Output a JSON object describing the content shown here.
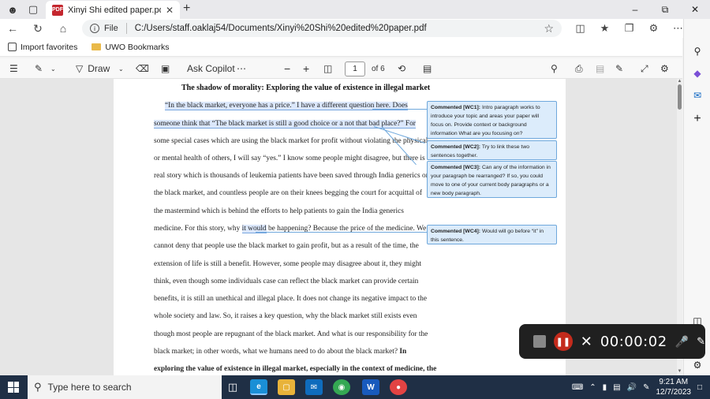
{
  "browser": {
    "tab_title": "Xinyi Shi edited paper.pdf",
    "address_label": "File",
    "url": "C:/Users/staff.oaklaj54/Documents/Xinyi%20Shi%20edited%20paper.pdf"
  },
  "bookmarks": {
    "import": "Import favorites",
    "folder": "UWO Bookmarks"
  },
  "pdf_toolbar": {
    "draw": "Draw",
    "ask_copilot": "Ask Copilot",
    "page_current": "1",
    "page_total": "of 6"
  },
  "document": {
    "title": "The shadow of morality: Exploring the value of existence in illegal market",
    "lines": [
      "“In the black market, everyone has a price.” I have a different question here. Does",
      "someone think that “The black market is still a good choice or a not that bad place?” For",
      "some special cases which are using the black market for profit without violating the physical",
      "or mental health of others, I will say “yes.” I know some people might disagree, but there is a",
      "real story which is thousands of leukemia patients have been saved through India generics on",
      "the black market, and countless people are on their knees begging the court for acquittal of",
      "the mastermind which is behind the efforts to help patients to gain the India generics",
      "medicine. For this story, why it would be happening? Because the price of the medicine. We",
      "cannot deny that people use the black market to gain profit, but as a result of the time, the",
      "extension of life is still a benefit. However, some people may disagree about it, they might",
      "think, even though some individuals case can reflect the black market can provide certain",
      "benefits, it is still an unethical and illegal place. It does not change its negative impact to the",
      "whole society and law. So, it raises a key question, why the black market still exists even",
      "though most people are repugnant of the black market. And what is our responsibility for the",
      "black market; in other words, what we humans need to do about the black market?",
      "exploring the value of existence in illegal market, especially in the context of medicine, the"
    ],
    "line14_bold_tail": "In",
    "highlight_phrase": "it would"
  },
  "comments": [
    {
      "label": "Commented [WC1]:",
      "text": "Intro    paragraph works to introduce your topic and areas your paper will focus on. Provide context or background information What are you focusing on?"
    },
    {
      "label": "Commented [WC2]:",
      "text": "Try to link these two sentences together."
    },
    {
      "label": "Commented [WC3]:",
      "text": "Can any of the information in your paragraph be rearranged? If so, you could move to one of your current body paragraphs or a new body paragraph."
    },
    {
      "label": "Commented [WC4]:",
      "text": "Would will go before “it” in this sentence."
    }
  ],
  "recorder": {
    "time": "00:00:02"
  },
  "taskbar": {
    "search_placeholder": "Type here to search",
    "time": "9:21 AM",
    "date": "12/7/2023"
  }
}
